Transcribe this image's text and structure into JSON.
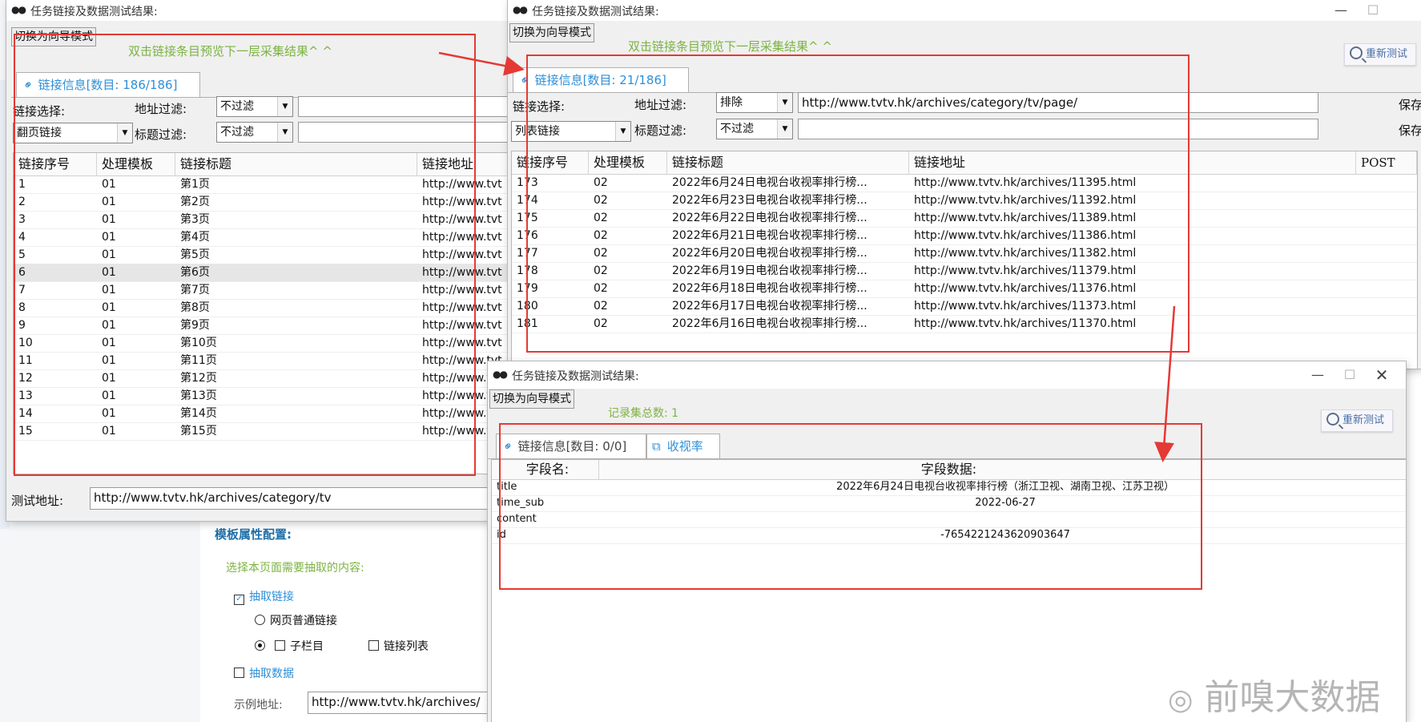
{
  "window1": {
    "title": "任务链接及数据测试结果:",
    "switch_btn": "切换为向导模式",
    "hint": "双击链接条目预览下一层采集结果^ ^",
    "tab_label": "链接信息[数目: 186/186]",
    "link_select_label": "链接选择:",
    "link_select_value": "翻页链接",
    "addr_filter_label": "地址过滤:",
    "addr_filter_value": "不过滤",
    "title_filter_label": "标题过滤:",
    "title_filter_value": "不过滤",
    "columns": [
      "链接序号",
      "处理模板",
      "链接标题",
      "链接地址"
    ],
    "rows": [
      {
        "no": "1",
        "tpl": "01",
        "title": "第1页",
        "url": "http://www.tvt"
      },
      {
        "no": "2",
        "tpl": "01",
        "title": "第2页",
        "url": "http://www.tvt"
      },
      {
        "no": "3",
        "tpl": "01",
        "title": "第3页",
        "url": "http://www.tvt"
      },
      {
        "no": "4",
        "tpl": "01",
        "title": "第4页",
        "url": "http://www.tvt"
      },
      {
        "no": "5",
        "tpl": "01",
        "title": "第5页",
        "url": "http://www.tvt"
      },
      {
        "no": "6",
        "tpl": "01",
        "title": "第6页",
        "url": "http://www.tvt"
      },
      {
        "no": "7",
        "tpl": "01",
        "title": "第7页",
        "url": "http://www.tvt"
      },
      {
        "no": "8",
        "tpl": "01",
        "title": "第8页",
        "url": "http://www.tvt"
      },
      {
        "no": "9",
        "tpl": "01",
        "title": "第9页",
        "url": "http://www.tvt"
      },
      {
        "no": "10",
        "tpl": "01",
        "title": "第10页",
        "url": "http://www.tvt"
      },
      {
        "no": "11",
        "tpl": "01",
        "title": "第11页",
        "url": "http://www.tvt"
      },
      {
        "no": "12",
        "tpl": "01",
        "title": "第12页",
        "url": "http://www.tvt"
      },
      {
        "no": "13",
        "tpl": "01",
        "title": "第13页",
        "url": "http://www.tvt"
      },
      {
        "no": "14",
        "tpl": "01",
        "title": "第14页",
        "url": "http://www.tvt"
      },
      {
        "no": "15",
        "tpl": "01",
        "title": "第15页",
        "url": "http://www.tvt"
      }
    ],
    "test_addr_label": "测试地址:",
    "test_addr_value": "http://www.tvtv.hk/archives/category/tv"
  },
  "window2": {
    "title": "任务链接及数据测试结果:",
    "switch_btn": "切换为向导模式",
    "hint": "双击链接条目预览下一层采集结果^ ^",
    "retest_btn": "重新测试",
    "tab_label": "链接信息[数目: 21/186]",
    "link_select_label": "链接选择:",
    "link_select_value": "列表链接",
    "addr_filter_label": "地址过滤:",
    "addr_filter_value": "排除",
    "addr_filter_text": "http://www.tvtv.hk/archives/category/tv/page/",
    "title_filter_label": "标题过滤:",
    "title_filter_value": "不过滤",
    "save_label": "保存",
    "columns": [
      "链接序号",
      "处理模板",
      "链接标题",
      "链接地址",
      "POST"
    ],
    "rows": [
      {
        "no": "173",
        "tpl": "02",
        "title": "2022年6月24日电视台收视率排行榜...",
        "url": "http://www.tvtv.hk/archives/11395.html"
      },
      {
        "no": "174",
        "tpl": "02",
        "title": "2022年6月23日电视台收视率排行榜...",
        "url": "http://www.tvtv.hk/archives/11392.html"
      },
      {
        "no": "175",
        "tpl": "02",
        "title": "2022年6月22日电视台收视率排行榜...",
        "url": "http://www.tvtv.hk/archives/11389.html"
      },
      {
        "no": "176",
        "tpl": "02",
        "title": "2022年6月21日电视台收视率排行榜...",
        "url": "http://www.tvtv.hk/archives/11386.html"
      },
      {
        "no": "177",
        "tpl": "02",
        "title": "2022年6月20日电视台收视率排行榜...",
        "url": "http://www.tvtv.hk/archives/11382.html"
      },
      {
        "no": "178",
        "tpl": "02",
        "title": "2022年6月19日电视台收视率排行榜...",
        "url": "http://www.tvtv.hk/archives/11379.html"
      },
      {
        "no": "179",
        "tpl": "02",
        "title": "2022年6月18日电视台收视率排行榜...",
        "url": "http://www.tvtv.hk/archives/11376.html"
      },
      {
        "no": "180",
        "tpl": "02",
        "title": "2022年6月17日电视台收视率排行榜...",
        "url": "http://www.tvtv.hk/archives/11373.html"
      },
      {
        "no": "181",
        "tpl": "02",
        "title": "2022年6月16日电视台收视率排行榜...",
        "url": "http://www.tvtv.hk/archives/11370.html"
      }
    ]
  },
  "window3": {
    "title": "任务链接及数据测试结果:",
    "switch_btn": "切换为向导模式",
    "record_total": "记录集总数: 1",
    "retest_btn": "重新测试",
    "tab1_label": "链接信息[数目: 0/0]",
    "tab2_label": "收视率",
    "col_field": "字段名:",
    "col_data": "字段数据:",
    "fields": [
      {
        "name": "title",
        "value": "2022年6月24日电视台收视率排行榜（浙江卫视、湖南卫视、江苏卫视）"
      },
      {
        "name": "time_sub",
        "value": "2022-06-27"
      },
      {
        "name": "content",
        "value": ""
      },
      {
        "name": "id",
        "value": "-7654221243620903647"
      }
    ]
  },
  "background_panel": {
    "section_title": "模板属性配置:",
    "extract_hint": "选择本页面需要抽取的内容:",
    "extract_links": "抽取链接",
    "normal_links": "网页普通链接",
    "sub_column": "子栏目",
    "link_list": "链接列表",
    "extract_data": "抽取数据",
    "example_addr_label": "示例地址:",
    "example_addr_value": "http://www.tvtv.hk/archives/"
  },
  "watermark": "前嗅大数据",
  "accent_red": "#e53935",
  "accent_green": "#7cb342",
  "accent_blue": "#2f8fd8"
}
